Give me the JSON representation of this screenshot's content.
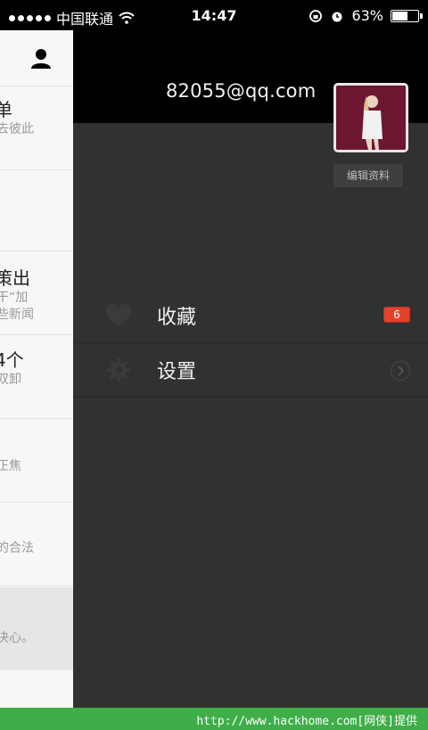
{
  "status_bar": {
    "carrier": "中国联通",
    "time": "14:47",
    "battery_text": "63%",
    "battery_level": 0.63
  },
  "feed": {
    "items": [
      {
        "title": "单",
        "subtitle": "去彼此"
      },
      {
        "title": "",
        "subtitle": ""
      },
      {
        "title": "策出",
        "subtitle": "干“加",
        "subtitle2": "些新闻"
      },
      {
        "title": "4个",
        "subtitle": "双卸"
      },
      {
        "title": "",
        "subtitle": "正焦"
      },
      {
        "title": "",
        "subtitle": "的合法"
      },
      {
        "title": "",
        "subtitle": "决心。"
      }
    ]
  },
  "drawer": {
    "email": "82055@qq.com",
    "edit_profile_label": "编辑资料",
    "menu": [
      {
        "label": "收藏",
        "icon": "heart-icon",
        "badge": "6"
      },
      {
        "label": "设置",
        "icon": "gear-icon"
      }
    ]
  },
  "watermark": {
    "text": "http://www.hackhome.com[网侠]提供"
  },
  "colors": {
    "accent_badge": "#e2412c",
    "watermark_bar": "#3fae49",
    "drawer_bg": "#303131",
    "avatar_bg": "#6d1630"
  }
}
